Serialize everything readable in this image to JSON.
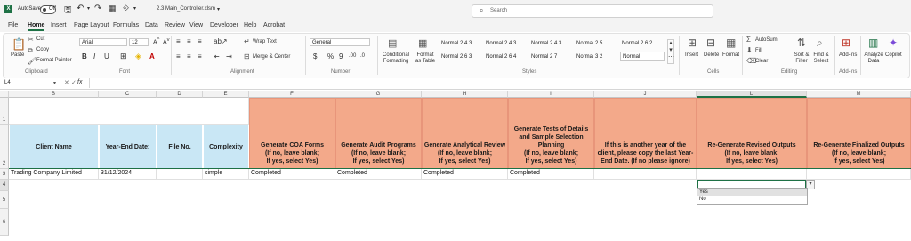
{
  "titlebar": {
    "autosave_label": "AutoSave",
    "autosave_state": "Off",
    "file_name": "2.3 Main_Controller.xlsm",
    "search_placeholder": "Search"
  },
  "tabs": [
    "File",
    "Home",
    "Insert",
    "Page Layout",
    "Formulas",
    "Data",
    "Review",
    "View",
    "Developer",
    "Help",
    "Acrobat"
  ],
  "active_tab": "Home",
  "ribbon": {
    "clipboard": {
      "paste": "Paste",
      "cut": "Cut",
      "copy": "Copy",
      "format_painter": "Format Painter",
      "group": "Clipboard"
    },
    "font": {
      "name": "Arial",
      "size": "12",
      "group": "Font"
    },
    "alignment": {
      "wrap": "Wrap Text",
      "merge": "Merge & Center",
      "group": "Alignment"
    },
    "number": {
      "format": "General",
      "group": "Number"
    },
    "styles": {
      "conditional": "Conditional Formatting",
      "format_as_table": "Format as Table",
      "cells_row1": [
        "Normal 2 4 3 ...",
        "Normal 2 4 3 ...",
        "Normal 2 4 3 ...",
        "Normal 2 5",
        "Normal 2 6 2"
      ],
      "cells_row2": [
        "Normal 2 6 3",
        "Normal 2 6 4",
        "Normal 2 7",
        "Normal 3 2",
        "Normal"
      ],
      "group": "Styles"
    },
    "cells": {
      "insert": "Insert",
      "delete": "Delete",
      "format": "Format",
      "group": "Cells"
    },
    "editing": {
      "autosum": "AutoSum",
      "fill": "Fill",
      "clear": "Clear",
      "sort": "Sort & Filter",
      "find": "Find & Select",
      "group": "Editing"
    },
    "addins": {
      "addins": "Add-ins",
      "group": "Add-ins"
    },
    "analyze": "Analyze Data",
    "copilot": "Copilot"
  },
  "formula_bar": {
    "name_box": "L4",
    "fx": "fx",
    "formula": ""
  },
  "columns": [
    "B",
    "C",
    "D",
    "E",
    "F",
    "G",
    "H",
    "I",
    "J",
    "L",
    "M"
  ],
  "rows": [
    "1",
    "2",
    "3",
    "4",
    "5",
    "6"
  ],
  "headers": {
    "client_name": "Client Name",
    "year_end": "Year-End Date:",
    "file_no": "File No.",
    "complexity": "Complexity",
    "coa": "Generate COA Forms\n(If no, leave blank;\nIf yes, select Yes)",
    "audit_programs": "Generate Audit Programs\n(If no, leave blank;\nIf yes, select Yes)",
    "analytical": "Generate Analytical Review\n(If no, leave blank;\nIf yes, select Yes)",
    "tests": "Generate Tests of Details\nand Sample Selection\nPlanning\n(If no, leave blank;\nIf yes, select Yes)",
    "another_year": "If this is another year of the\nclient, please copy the last Year-\nEnd Date. (If no please ignore)",
    "revised": "Re-Generate Revised Outputs\n(If no, leave blank;\nIf yes, select Yes)",
    "finalized": "Re-Generate Finalized Outputs\n(If no, leave blank;\nIf yes, select Yes)"
  },
  "data_row": {
    "client_name": "Trading Company Limited",
    "year_end": "31/12/2024",
    "file_no": "",
    "complexity": "simple",
    "coa": "Completed",
    "audit_programs": "Completed",
    "analytical": "Completed",
    "tests": "Completed"
  },
  "dropdown_options": [
    "Yes",
    "No"
  ],
  "colors": {
    "header_blue": "#c9e7f5",
    "header_orange": "#f3a98a",
    "excel_green": "#1e7145"
  }
}
